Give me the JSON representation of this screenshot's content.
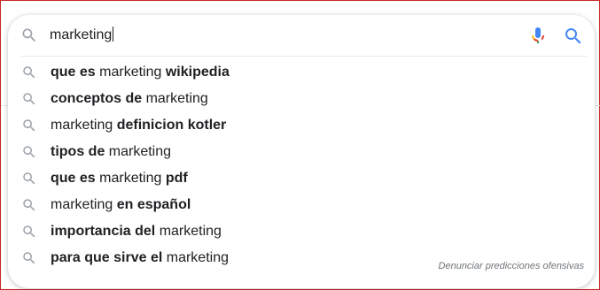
{
  "search": {
    "value": "marketing",
    "icons": {
      "lead": "search-icon",
      "mic": "microphone-icon",
      "submit": "search-icon"
    },
    "colors": {
      "mic_blue": "#4285f4",
      "mic_red": "#ea4335",
      "mic_yellow": "#fbbc05",
      "mic_green": "#34a853",
      "submit_blue": "#4285f4",
      "icon_grey": "#9aa0a6"
    }
  },
  "suggestions": [
    {
      "parts": [
        {
          "text": "que es ",
          "bold": true
        },
        {
          "text": "marketing ",
          "bold": false
        },
        {
          "text": "wikipedia",
          "bold": true
        }
      ]
    },
    {
      "parts": [
        {
          "text": "conceptos de ",
          "bold": true
        },
        {
          "text": "marketing",
          "bold": false
        }
      ]
    },
    {
      "parts": [
        {
          "text": "marketing ",
          "bold": false
        },
        {
          "text": "definicion kotler",
          "bold": true
        }
      ]
    },
    {
      "parts": [
        {
          "text": "tipos de ",
          "bold": true
        },
        {
          "text": "marketing",
          "bold": false
        }
      ]
    },
    {
      "parts": [
        {
          "text": "que es ",
          "bold": true
        },
        {
          "text": "marketing ",
          "bold": false
        },
        {
          "text": "pdf",
          "bold": true
        }
      ]
    },
    {
      "parts": [
        {
          "text": "marketing ",
          "bold": false
        },
        {
          "text": "en español",
          "bold": true
        }
      ]
    },
    {
      "parts": [
        {
          "text": "importancia del ",
          "bold": true
        },
        {
          "text": "marketing",
          "bold": false
        }
      ]
    },
    {
      "parts": [
        {
          "text": "para que sirve el ",
          "bold": true
        },
        {
          "text": "marketing",
          "bold": false
        }
      ]
    }
  ],
  "footer": {
    "report_label": "Denunciar predicciones ofensivas"
  }
}
